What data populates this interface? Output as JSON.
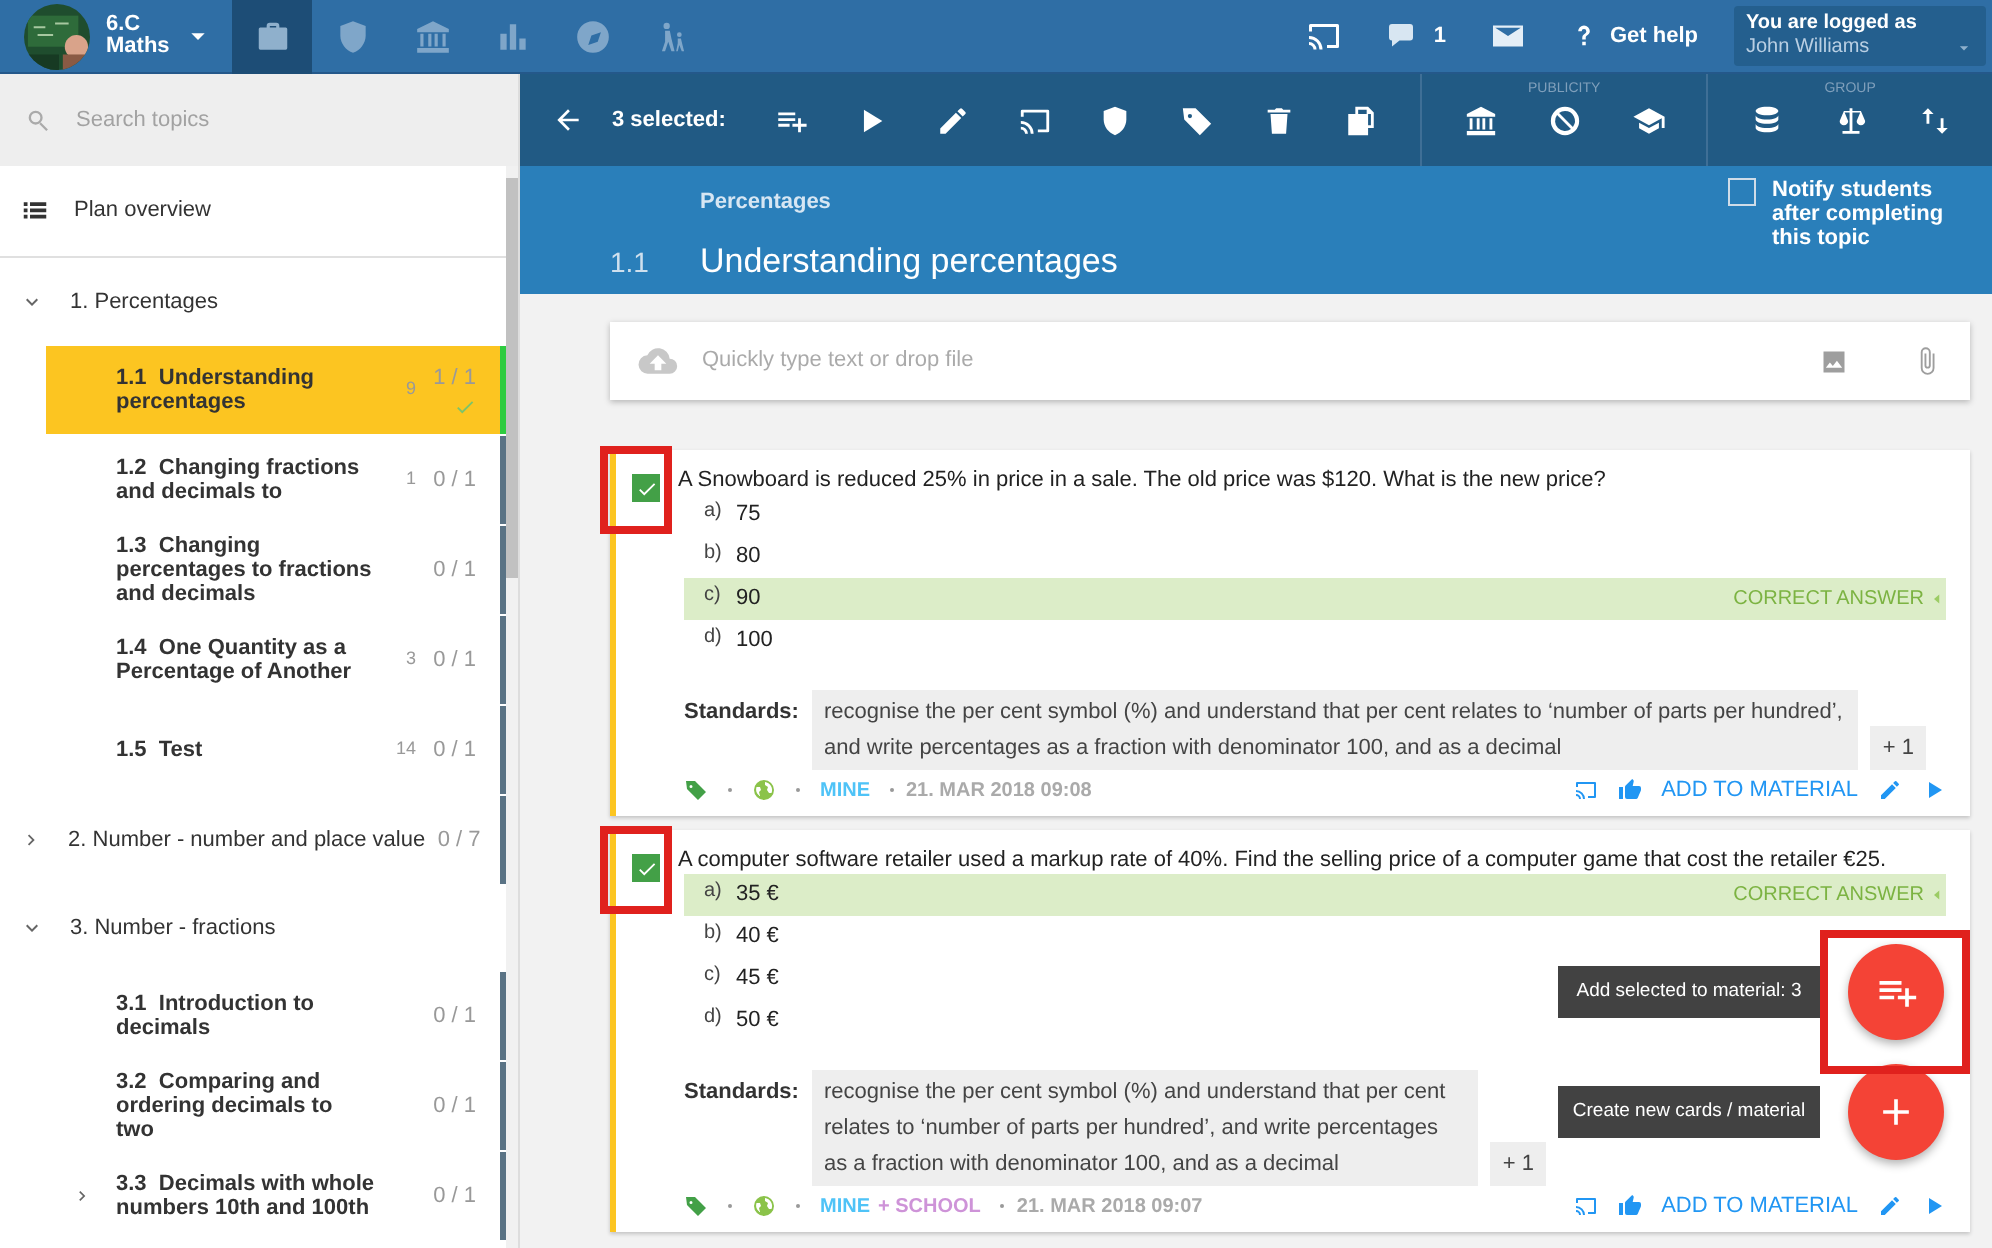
{
  "header": {
    "class_name": "6.C",
    "subject": "Maths",
    "nav": [
      {
        "kind": "briefcase",
        "selected": true
      },
      {
        "kind": "shield",
        "selected": false
      },
      {
        "kind": "bank",
        "selected": false
      },
      {
        "kind": "chart",
        "selected": false
      },
      {
        "kind": "compass",
        "selected": false
      },
      {
        "kind": "hikers",
        "selected": false
      }
    ],
    "messages_count": "1",
    "help": "Get help",
    "user": {
      "label": "You are logged as",
      "name": "John Williams"
    }
  },
  "sidebar": {
    "search": {
      "placeholder": "Search topics"
    },
    "overview": "Plan overview",
    "topics": [
      {
        "label": "1. Percentages",
        "expanded": true,
        "children": [
          {
            "number": "1.1",
            "title": "Understanding percentages",
            "count": "9",
            "progress": "1 / 1",
            "selected": true,
            "completed": true
          },
          {
            "number": "1.2",
            "title": "Changing fractions and decimals to",
            "count": "1",
            "progress": "0 / 1",
            "selected": false,
            "completed": false
          },
          {
            "number": "1.3",
            "title": "Changing percentages to fractions and decimals",
            "progress": "0 / 1",
            "selected": false,
            "completed": false
          },
          {
            "number": "1.4",
            "title": "One Quantity as a Percentage of Another",
            "count": "3",
            "progress": "0 / 1",
            "selected": false,
            "completed": false
          },
          {
            "number": "1.5",
            "title": "Test",
            "count": "14",
            "progress": "0 / 1",
            "selected": false,
            "completed": false
          }
        ]
      },
      {
        "label": "2. Number - number and place value",
        "expanded": false,
        "progress": "0 / 7"
      },
      {
        "label": "3. Number - fractions",
        "expanded": true,
        "children": [
          {
            "number": "3.1",
            "title": "Introduction to decimals",
            "progress": "0 / 1",
            "selected": false,
            "completed": false
          },
          {
            "number": "3.2",
            "title": "Comparing and ordering decimals to two",
            "progress": "0 / 1",
            "selected": false,
            "completed": false
          },
          {
            "number": "3.3",
            "title": "Decimals with whole numbers 10th and 100th",
            "progress": "0 / 1",
            "selected": false,
            "completed": false,
            "expanded": false
          }
        ]
      }
    ]
  },
  "toolbar": {
    "selection": "3 selected:",
    "publicity_label": "PUBLICITY",
    "group_label": "GROUP"
  },
  "topic": {
    "section": "Percentages",
    "number": "1.1",
    "title": "Understanding percentages",
    "notify": {
      "label": "Notify students after completing this topic",
      "checked": false
    }
  },
  "quick_input": {
    "placeholder": "Quickly type text or drop file"
  },
  "cards": [
    {
      "selected": true,
      "question": "A Snowboard is reduced 25% in price in a sale. The old price was $120. What is the new price?",
      "options": [
        {
          "letter": "a)",
          "text": "75",
          "correct": false
        },
        {
          "letter": "b)",
          "text": "80",
          "correct": false
        },
        {
          "letter": "c)",
          "text": "90",
          "correct": true,
          "note": "CORRECT ANSWER"
        },
        {
          "letter": "d)",
          "text": "100",
          "correct": false
        }
      ],
      "standards_label": "Standards:",
      "standard": "recognise the per cent symbol (%) and understand that per cent relates to ‘number of parts per hundred’, and write percentages as a fraction with denominator 100, and as a decimal",
      "more": "+ 1",
      "owners": [
        {
          "text": "MINE",
          "color": "#4fc3f7"
        }
      ],
      "date": "21. MAR 2018 09:08",
      "add": "ADD TO MATERIAL"
    },
    {
      "selected": true,
      "question": "A computer software retailer used a markup rate of 40%. Find the selling price of a computer game that cost the retailer €25.",
      "options": [
        {
          "letter": "a)",
          "text": "35 €",
          "correct": true,
          "note": "CORRECT ANSWER"
        },
        {
          "letter": "b)",
          "text": "40 €",
          "correct": false
        },
        {
          "letter": "c)",
          "text": "45 €",
          "correct": false
        },
        {
          "letter": "d)",
          "text": "50 €",
          "correct": false
        }
      ],
      "standards_label": "Standards:",
      "standard": "recognise the per cent symbol (%) and understand that per cent relates to ‘number of parts per hundred’, and write percentages as a fraction with denominator 100, and as a decimal",
      "more": "+ 1",
      "owners": [
        {
          "text": "MINE",
          "color": "#4fc3f7"
        },
        {
          "text": "+ SCHOOL",
          "color": "#ce93d8"
        }
      ],
      "date": "21. MAR 2018 09:07",
      "add": "ADD TO MATERIAL"
    }
  ],
  "fabs": [
    {
      "tooltip": "Add selected to material: 3",
      "kind": "playlist-add"
    },
    {
      "tooltip": "Create new cards / material",
      "kind": "plus"
    }
  ]
}
